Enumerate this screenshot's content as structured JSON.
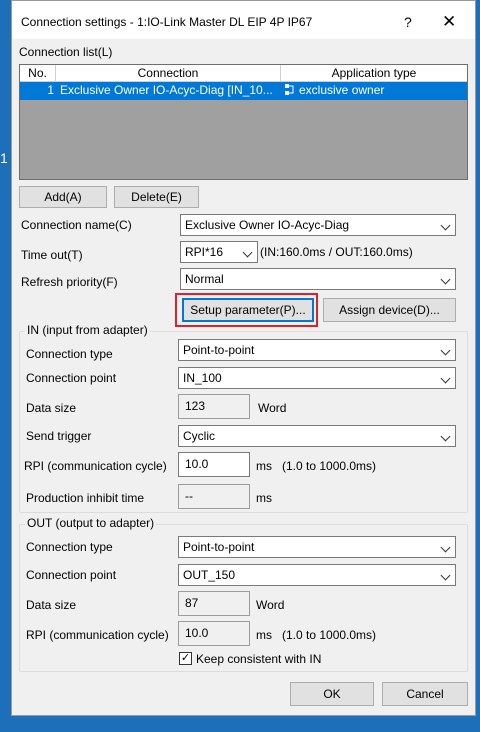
{
  "edge_mark": "1",
  "window": {
    "title": "Connection settings  - 1:IO-Link Master DL EIP 4P IP67",
    "help_glyph": "?",
    "close_glyph": "✕"
  },
  "connection_list": {
    "label": "Connection list(L)",
    "columns": [
      "No.",
      "Connection",
      "Application type"
    ],
    "rows": [
      {
        "no": "1",
        "connection": "Exclusive Owner IO-Acyc-Diag [IN_10...",
        "application_type": "exclusive owner",
        "icon": "connection-owner-icon"
      }
    ]
  },
  "buttons": {
    "add": "Add(A)",
    "delete": "Delete(E)",
    "setup_parameter": "Setup parameter(P)...",
    "assign_device": "Assign device(D)...",
    "ok": "OK",
    "cancel": "Cancel"
  },
  "connection_name": {
    "label": "Connection name(C)",
    "value": "Exclusive Owner IO-Acyc-Diag"
  },
  "timeout": {
    "label": "Time out(T)",
    "value": "RPI*16",
    "info": "(IN:160.0ms / OUT:160.0ms)"
  },
  "refresh_priority": {
    "label": "Refresh priority(F)",
    "value": "Normal"
  },
  "in_group": {
    "title": "IN (input from adapter)",
    "connection_type": {
      "label": "Connection type",
      "value": "Point-to-point"
    },
    "connection_point": {
      "label": "Connection point",
      "value": "IN_100"
    },
    "data_size": {
      "label": "Data size",
      "value": "123",
      "unit": "Word"
    },
    "send_trigger": {
      "label": "Send trigger",
      "value": "Cyclic"
    },
    "rpi": {
      "label": "RPI (communication cycle)",
      "value": "10.0",
      "unit": "ms",
      "range": "(1.0 to 1000.0ms)"
    },
    "production_inhibit": {
      "label": "Production inhibit time",
      "value": "--",
      "unit": "ms"
    }
  },
  "out_group": {
    "title": "OUT (output to adapter)",
    "connection_type": {
      "label": "Connection type",
      "value": "Point-to-point"
    },
    "connection_point": {
      "label": "Connection point",
      "value": "OUT_150"
    },
    "data_size": {
      "label": "Data size",
      "value": "87",
      "unit": "Word"
    },
    "rpi": {
      "label": "RPI (communication cycle)",
      "value": "10.0",
      "unit": "ms",
      "range": "(1.0 to 1000.0ms)"
    },
    "keep_consistent": {
      "label": "Keep consistent with IN",
      "checked": true,
      "check_glyph": "✓"
    }
  },
  "colors": {
    "selection": "#0078d7",
    "highlight_box": "#e0202a",
    "desktop": "#1e6fb9"
  }
}
